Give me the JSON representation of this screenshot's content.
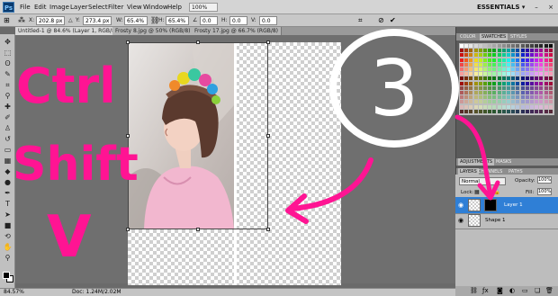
{
  "app": {
    "logo": "Ps",
    "essentials": "ESSENTIALS ▾",
    "zoom": "100%"
  },
  "menu": [
    "File",
    "Edit",
    "Image",
    "Layer",
    "Select",
    "Filter",
    "View",
    "Window",
    "Help"
  ],
  "options": {
    "x_label": "X:",
    "x_value": "202.8 px",
    "y_label": "Y:",
    "y_value": "273.4 px",
    "w_label": "W:",
    "w_value": "65.4%",
    "h_label": "H:",
    "h_value": "65.4%",
    "angle_value": "0.0",
    "h_skew_label": "H:",
    "h_skew_value": "0.0",
    "v_skew_label": "V:",
    "v_skew_value": "0.0"
  },
  "tabs": [
    {
      "label": "Untitled-1 @ 84.6% (Layer 1, RGB/8) *"
    },
    {
      "label": "Frosty 8.jpg @ 50% (RGB/8)"
    },
    {
      "label": "Frosty 17.jpg @ 66.7% (RGB/8)"
    }
  ],
  "status": {
    "zoom": "84.57%",
    "doc": "Doc: 1.24M/2.02M"
  },
  "panels": {
    "top_tabs": [
      "COLOR",
      "SWATCHES",
      "STYLES"
    ],
    "mid_tabs": [
      "ADJUSTMENTS",
      "MASKS"
    ],
    "layer_tabs": [
      "LAYERS",
      "CHANNELS",
      "PATHS"
    ],
    "blend_mode": "Normal",
    "opacity_label": "Opacity:",
    "opacity_value": "100%",
    "lock_label": "Lock:",
    "fill_label": "Fill:",
    "fill_value": "100%",
    "layers": [
      {
        "name": "Layer 1",
        "selected": true
      },
      {
        "name": "Shape 1",
        "selected": false
      }
    ]
  },
  "annotations": {
    "line1": "Ctrl",
    "line2": "Shift",
    "line3": "V",
    "step_number": "3",
    "color": "#ff1493"
  }
}
